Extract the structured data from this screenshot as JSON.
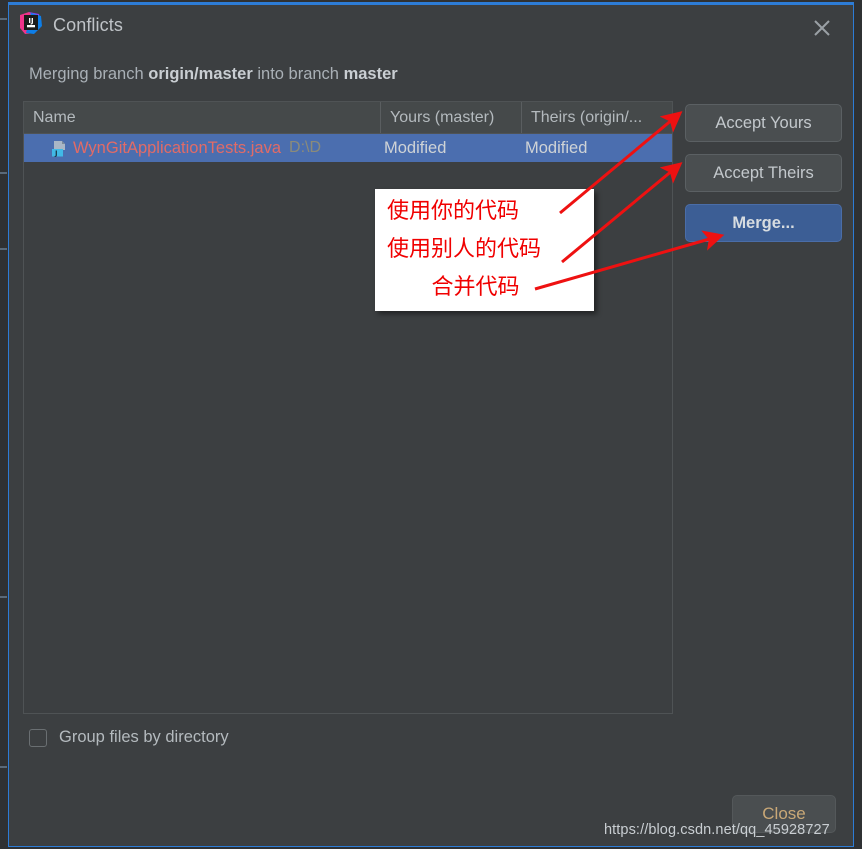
{
  "window": {
    "title": "Conflicts",
    "app_icon": "intellij-idea-icon",
    "close_icon": "close-icon",
    "focus_border_color": "#2d7cd6",
    "background": "#3c3f41"
  },
  "subtitle": {
    "prefix": "Merging branch ",
    "source_branch": "origin/master",
    "middle": " into branch ",
    "target_branch": "master"
  },
  "table": {
    "columns": [
      {
        "key": "name",
        "label": "Name"
      },
      {
        "key": "yours",
        "label": "Yours (master)"
      },
      {
        "key": "theirs",
        "label": "Theirs (origin/..."
      }
    ],
    "rows": [
      {
        "icon": "java-file-icon",
        "name": "WynGitApplicationTests.java",
        "path": "D:\\D",
        "yours": "Modified",
        "theirs": "Modified",
        "selected": true,
        "name_color": "#e26b66",
        "selected_color": "#4b6eaf"
      }
    ]
  },
  "buttons": {
    "accept_yours": "Accept Yours",
    "accept_theirs": "Accept Theirs",
    "merge": "Merge...",
    "merge_accent": "#3c5e95",
    "close": "Close",
    "close_text_color": "#c9a877"
  },
  "options": {
    "group_files_label": "Group files by directory",
    "group_files_checked": false
  },
  "annotation": {
    "color": "#f00000",
    "lines": [
      "使用你的代码",
      "使用别人的代码",
      "合并代码"
    ],
    "arrow_count": 3
  },
  "watermark": {
    "text": "https://blog.csdn.net/qq_45928727"
  }
}
